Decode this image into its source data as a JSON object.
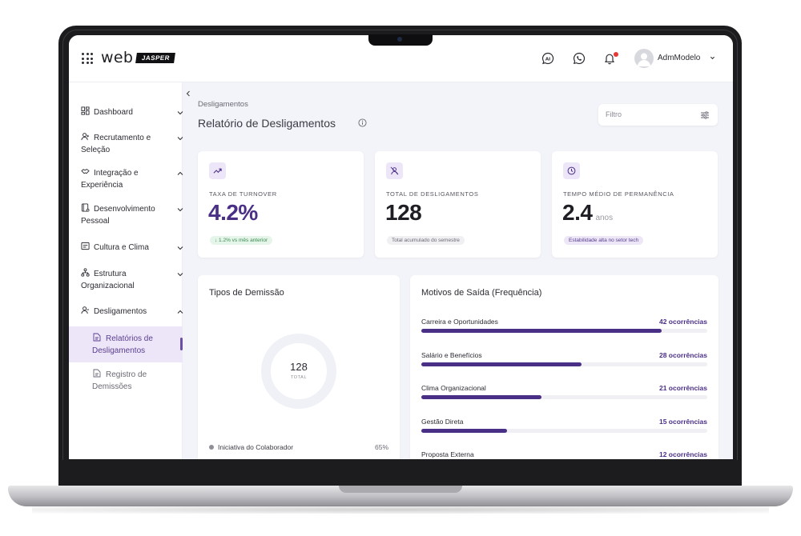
{
  "header": {
    "logo_text": "web",
    "logo_badge": "JASPER",
    "user_name": "AdmModelo",
    "icons": [
      "apps-grid-icon",
      "ai-chat-icon",
      "whatsapp-icon",
      "bell-icon",
      "user-avatar-icon",
      "chevron-down-icon"
    ]
  },
  "sidebar": {
    "items": [
      {
        "label": "Dashboard",
        "icon": "dashboard-icon",
        "expanded": false
      },
      {
        "label": "Recrutamento e Seleção",
        "icon": "user-plus-icon",
        "expanded": false
      },
      {
        "label": "Integração e Experiência",
        "icon": "handshake-icon",
        "expanded": true
      },
      {
        "label": "Desenvolvimento Pessoal",
        "icon": "book-icon",
        "expanded": false
      },
      {
        "label": "Cultura e Clima",
        "icon": "window-icon",
        "expanded": false
      },
      {
        "label": "Estrutura Organizacional",
        "icon": "org-chart-icon",
        "expanded": false
      },
      {
        "label": "Desligamentos",
        "icon": "user-minus-icon",
        "expanded": true
      }
    ],
    "subitems": [
      {
        "label": "Relatórios de Desligamentos",
        "icon": "document-icon",
        "active": true
      },
      {
        "label": "Registro de Demissões",
        "icon": "document-icon",
        "active": false
      }
    ]
  },
  "main": {
    "breadcrumb": "Desligamentos",
    "title": "Relatório de Desligamentos",
    "filter_placeholder": "Filtro"
  },
  "kpis": [
    {
      "label": "TAXA DE TURNOVER",
      "value": "4.2%",
      "unit": "",
      "badge": "↓ 1.2% vs mês anterior",
      "icon": "trending-up-icon"
    },
    {
      "label": "TOTAL DE DESLIGAMENTOS",
      "value": "128",
      "unit": "",
      "badge": "Total acumulado do semestre",
      "icon": "user-off-icon"
    },
    {
      "label": "TEMPO MÉDIO DE PERMANÊNCIA",
      "value": "2.4",
      "unit": "anos",
      "badge": "Estabilidade alta no setor tech",
      "icon": "clock-icon"
    }
  ],
  "dismissal_types": {
    "title": "Tipos de Demissão",
    "total_value": "128",
    "total_label": "TOTAL",
    "legend": [
      {
        "name": "Iniciativa do Colaborador",
        "percent": "65%",
        "color": "#8f8f97"
      }
    ]
  },
  "exit_reasons": {
    "title": "Motivos de Saída (Frequência)",
    "max": 50,
    "items": [
      {
        "name": "Carreira e Oportunidades",
        "count": 42,
        "count_label": "42 ocorrências"
      },
      {
        "name": "Salário e Benefícios",
        "count": 28,
        "count_label": "28 ocorrências"
      },
      {
        "name": "Clima Organizacional",
        "count": 21,
        "count_label": "21 ocorrências"
      },
      {
        "name": "Gestão Direta",
        "count": 15,
        "count_label": "15 ocorrências"
      },
      {
        "name": "Proposta Externa",
        "count": 12,
        "count_label": "12 ocorrências"
      }
    ]
  },
  "colors": {
    "accent": "#4a2f86",
    "accent_light": "#ede6f8",
    "background": "#f3f4f9",
    "notification": "#e53935"
  }
}
